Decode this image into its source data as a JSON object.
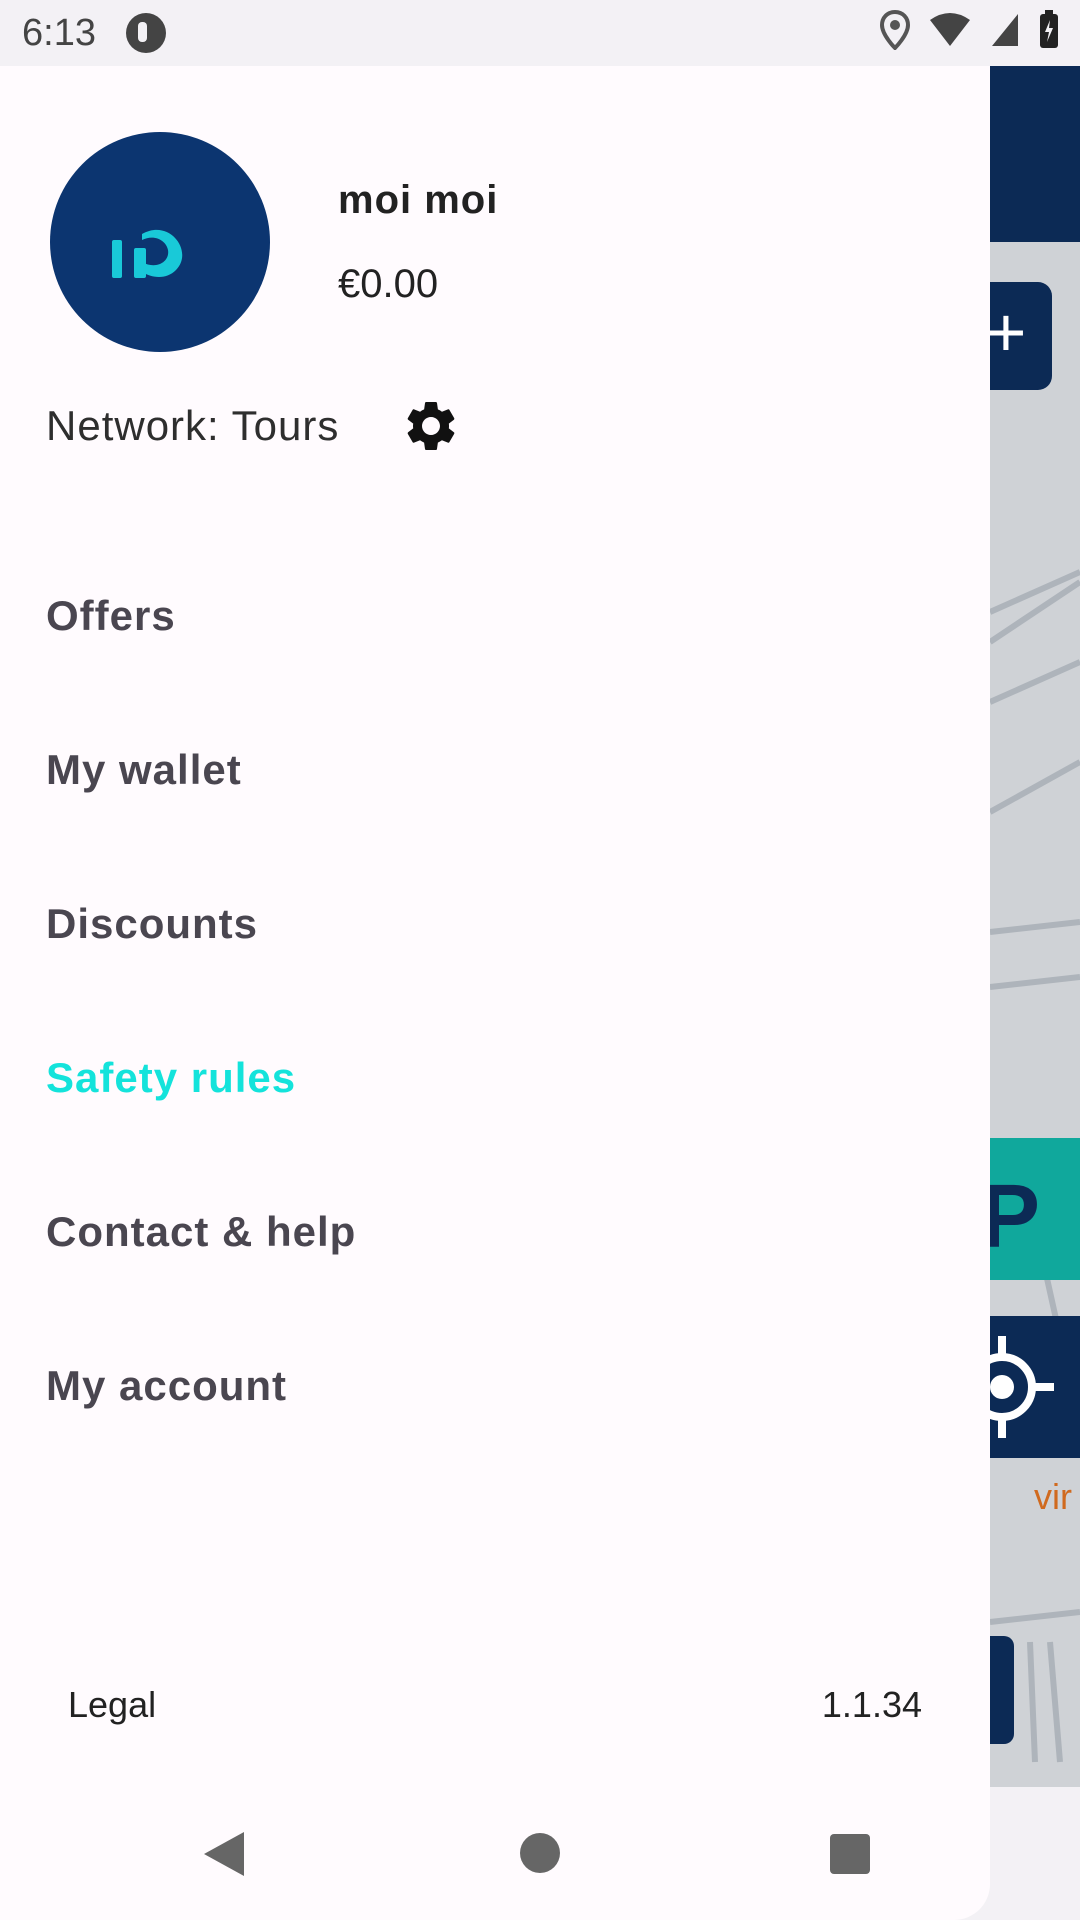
{
  "status_bar": {
    "time": "6:13",
    "icons": [
      "app-notification-icon",
      "location-icon",
      "wifi-icon",
      "signal-icon",
      "battery-icon"
    ]
  },
  "drawer": {
    "user": {
      "name": "moi moi",
      "balance": "€0.00"
    },
    "network": "Network: Tours",
    "menu": [
      {
        "label": "Offers",
        "active": false
      },
      {
        "label": "My wallet",
        "active": false
      },
      {
        "label": "Discounts",
        "active": false
      },
      {
        "label": "Safety rules",
        "active": true
      },
      {
        "label": "Contact & help",
        "active": false
      },
      {
        "label": "My account",
        "active": false
      }
    ],
    "footer": {
      "legal": "Legal",
      "version": "1.1.34"
    }
  },
  "background_app": {
    "map_label_fragment": "vir"
  },
  "colors": {
    "brand_dark": "#0c2a55",
    "accent_active": "#14e3db",
    "parking_green": "#10a89c"
  }
}
